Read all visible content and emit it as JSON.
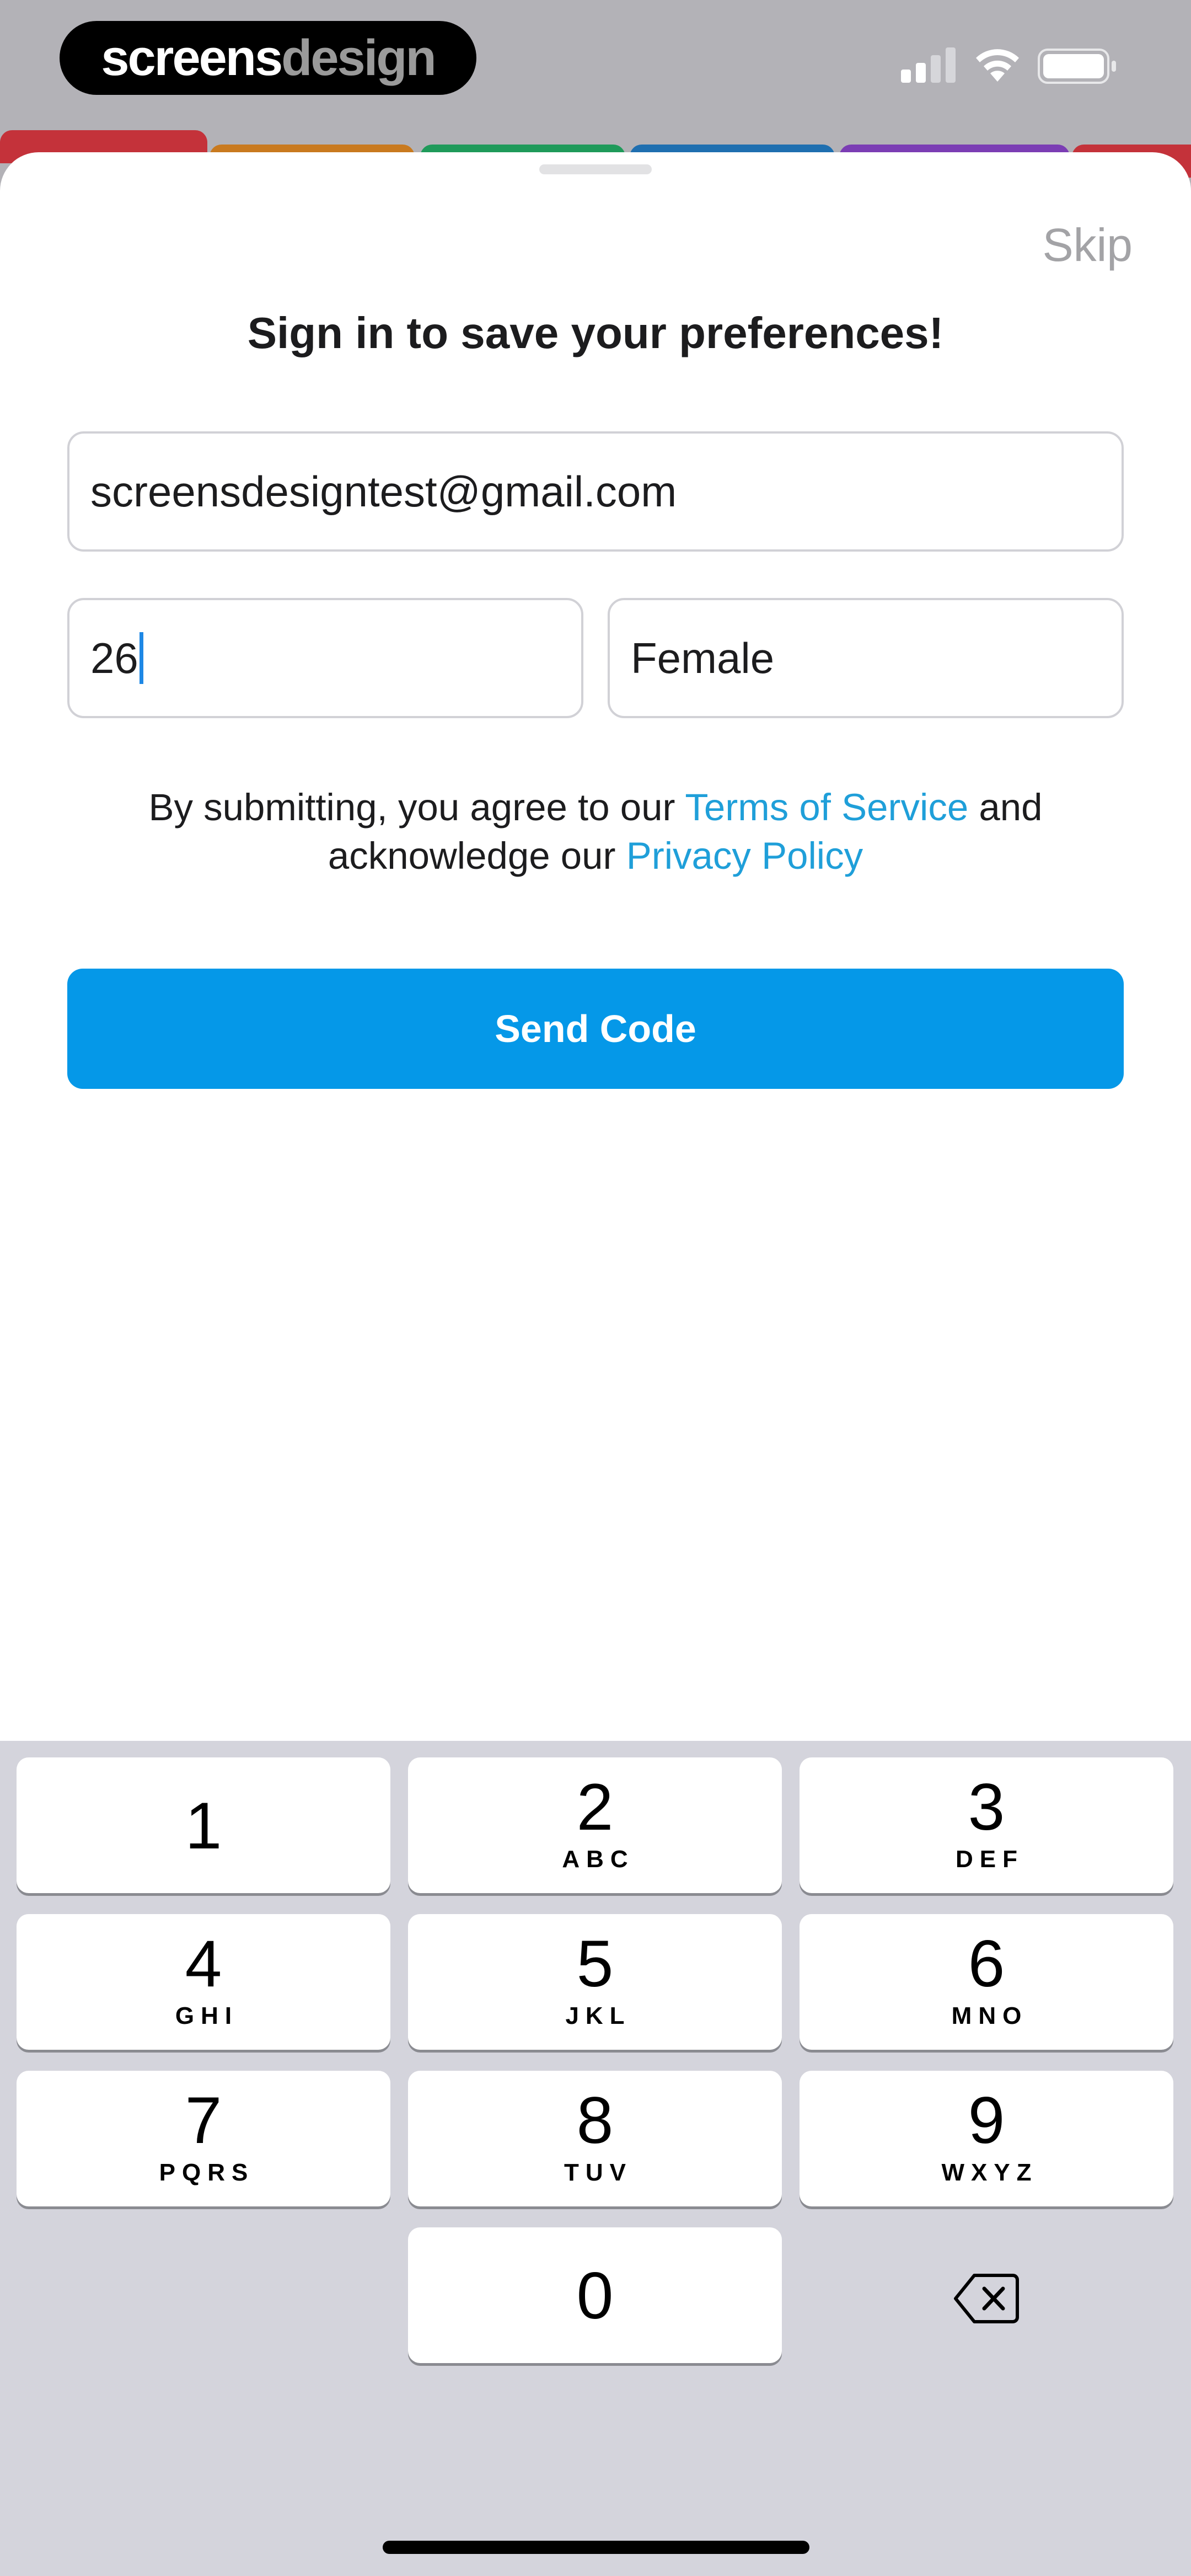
{
  "status_bar": {
    "brand_part1": "screens",
    "brand_part2": "design",
    "signal_icon": "cellular-signal-icon",
    "wifi_icon": "wifi-icon",
    "battery_icon": "battery-icon"
  },
  "card_colors": [
    "#c4323a",
    "#c97a1f",
    "#1f9a5a",
    "#1f6fb0",
    "#7b3db4",
    "#c4323a"
  ],
  "sheet": {
    "skip_label": "Skip",
    "title": "Sign in to save your preferences!",
    "email_value": "screensdesigntest@gmail.com",
    "age_value": "26",
    "gender_value": "Female",
    "legal_prefix": "By submitting, you agree to our ",
    "terms_link": "Terms of Service",
    "legal_middle": " and acknowledge our ",
    "privacy_link": "Privacy Policy",
    "send_button": "Send Code"
  },
  "keypad": {
    "keys": [
      {
        "num": "1",
        "letters": ""
      },
      {
        "num": "2",
        "letters": "ABC"
      },
      {
        "num": "3",
        "letters": "DEF"
      },
      {
        "num": "4",
        "letters": "GHI"
      },
      {
        "num": "5",
        "letters": "JKL"
      },
      {
        "num": "6",
        "letters": "MNO"
      },
      {
        "num": "7",
        "letters": "PQRS"
      },
      {
        "num": "8",
        "letters": "TUV"
      },
      {
        "num": "9",
        "letters": "WXYZ"
      },
      {
        "num": "0",
        "letters": ""
      }
    ],
    "backspace_icon": "backspace-icon"
  },
  "colors": {
    "accent": "#0598e8",
    "link": "#1f9fd9"
  }
}
